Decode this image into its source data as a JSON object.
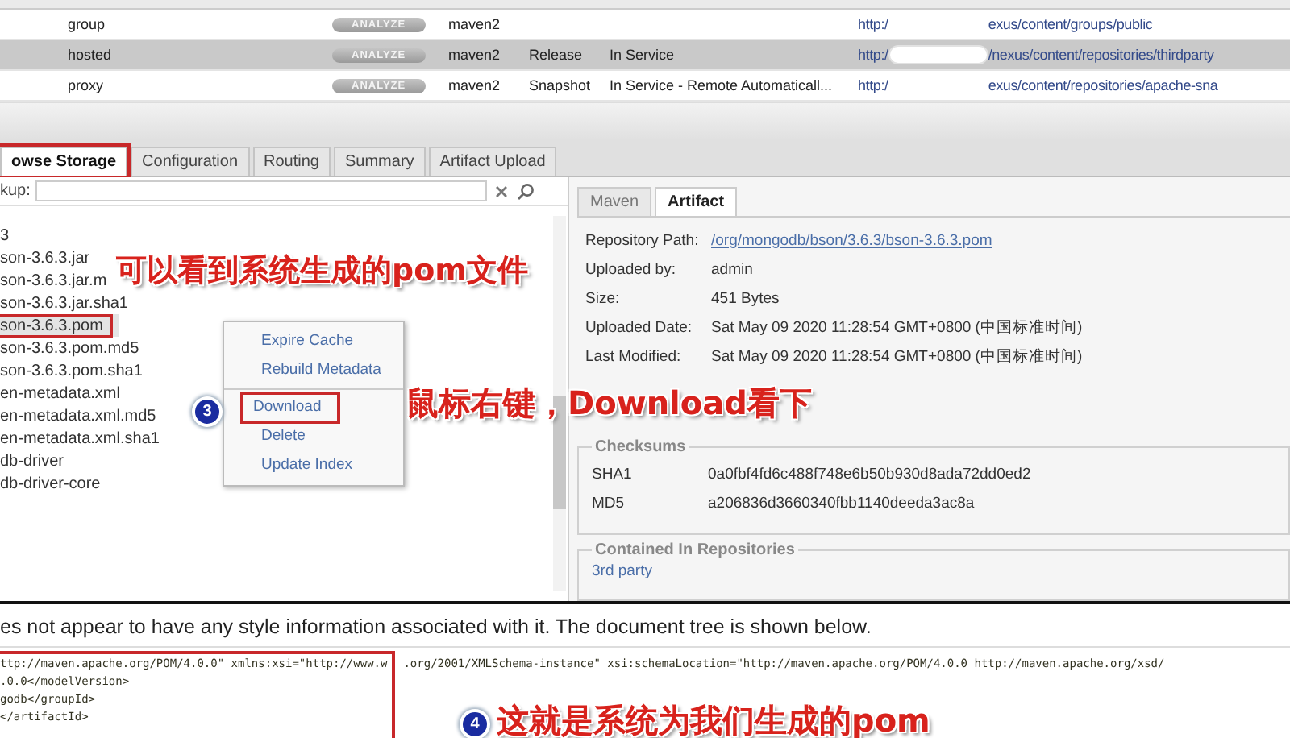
{
  "repositories": {
    "rows": [
      {
        "type": "group",
        "health_check": "ANALYZE",
        "format": "maven2",
        "path_start": "http:/",
        "path_end": "exus/content/groups/public",
        "selected": false,
        "redacted": false
      },
      {
        "type": "hosted",
        "health_check": "ANALYZE",
        "format": "maven2",
        "policy": "Release",
        "status": "In Service",
        "path_start": "http:/",
        "path_end": "/nexus/content/repositories/thirdparty",
        "selected": true,
        "redacted": true
      },
      {
        "type": "proxy",
        "health_check": "ANALYZE",
        "format": "maven2",
        "policy": "Snapshot",
        "status": "In Service - Remote Automaticall...",
        "path_start": "http:/",
        "path_end": "exus/content/repositories/apache-sna",
        "selected": false,
        "redacted": false
      }
    ]
  },
  "tabs": [
    {
      "label": "owse Storage",
      "selected": true,
      "annotated": true
    },
    {
      "label": "Configuration",
      "selected": false,
      "annotated": false
    },
    {
      "label": "Routing",
      "selected": false,
      "annotated": false
    },
    {
      "label": "Summary",
      "selected": false,
      "annotated": false
    },
    {
      "label": "Artifact Upload",
      "selected": false,
      "annotated": false
    }
  ],
  "lookup": {
    "label": "kup:"
  },
  "tree": {
    "items": [
      {
        "label": "3",
        "selected": false,
        "annotated": false
      },
      {
        "label": "son-3.6.3.jar",
        "selected": false,
        "annotated": false
      },
      {
        "label": "son-3.6.3.jar.m",
        "selected": false,
        "annotated": false
      },
      {
        "label": "son-3.6.3.jar.sha1",
        "selected": false,
        "annotated": false
      },
      {
        "label": "son-3.6.3.pom",
        "selected": true,
        "annotated": true
      },
      {
        "label": "son-3.6.3.pom.md5",
        "selected": false,
        "annotated": false
      },
      {
        "label": "son-3.6.3.pom.sha1",
        "selected": false,
        "annotated": false
      },
      {
        "label": "en-metadata.xml",
        "selected": false,
        "annotated": false
      },
      {
        "label": "en-metadata.xml.md5",
        "selected": false,
        "annotated": false
      },
      {
        "label": "en-metadata.xml.sha1",
        "selected": false,
        "annotated": false
      },
      {
        "label": "db-driver",
        "selected": false,
        "annotated": false
      },
      {
        "label": "db-driver-core",
        "selected": false,
        "annotated": false
      }
    ]
  },
  "context_menu": {
    "step": "3",
    "items": [
      {
        "label": "Expire Cache",
        "annotated": false,
        "divider_after": false
      },
      {
        "label": "Rebuild Metadata",
        "annotated": false,
        "divider_after": true
      },
      {
        "label": "Download",
        "annotated": true,
        "divider_after": false
      },
      {
        "label": "Delete",
        "annotated": false,
        "divider_after": false
      },
      {
        "label": "Update Index",
        "annotated": false,
        "divider_after": false
      }
    ]
  },
  "detail_tabs": [
    {
      "label": "Maven",
      "selected": false
    },
    {
      "label": "Artifact",
      "selected": true
    }
  ],
  "details": [
    {
      "label": "Repository Path:",
      "value": "/org/mongodb/bson/3.6.3/bson-3.6.3.pom",
      "kind": "link"
    },
    {
      "label": "Uploaded by:",
      "value": "admin",
      "kind": "text"
    },
    {
      "label": "Size:",
      "value": "451 Bytes",
      "kind": "text"
    },
    {
      "label": "Uploaded Date:",
      "value": "Sat May 09 2020 11:28:54 GMT+0800 (中国标准时间)",
      "kind": "text"
    },
    {
      "label": "Last Modified:",
      "value": "Sat May 09 2020 11:28:54 GMT+0800 (中国标准时间)",
      "kind": "text"
    }
  ],
  "checksums": {
    "title": "Checksums",
    "rows": [
      {
        "label": "SHA1",
        "value": "0a0fbf4fd6c488f748e6b50b930d8ada72dd0ed2"
      },
      {
        "label": "MD5",
        "value": "a206836d3660340fbb1140deeda3ac8a"
      }
    ]
  },
  "contained": {
    "title": "Contained In Repositories",
    "items": [
      "3rd party"
    ]
  },
  "xml_view": {
    "message": "es not appear to have any style information associated with it. The document tree is shown below.",
    "lines": [
      [
        "ttp://maven.apache.org/POM/4.0.0\" xmlns:xsi=\"http://www.w",
        ".org/2001/XMLSchema-instance\" xsi:schemaLocation=\"http://maven.apache.org/POM/4.0.0 http://maven.apache.org/xsd/"
      ],
      [
        ".0.0</modelVersion>"
      ],
      [
        "godb</groupId>"
      ],
      [
        "</artifactId>"
      ]
    ]
  },
  "annotations": [
    {
      "kind": "file-note",
      "text": "可以看到系统生成的pom文件"
    },
    {
      "kind": "menu-note",
      "text": "鼠标右键，Download看下"
    },
    {
      "kind": "pom-note",
      "text": "这就是系统为我们生成的pom",
      "step": "4"
    }
  ]
}
